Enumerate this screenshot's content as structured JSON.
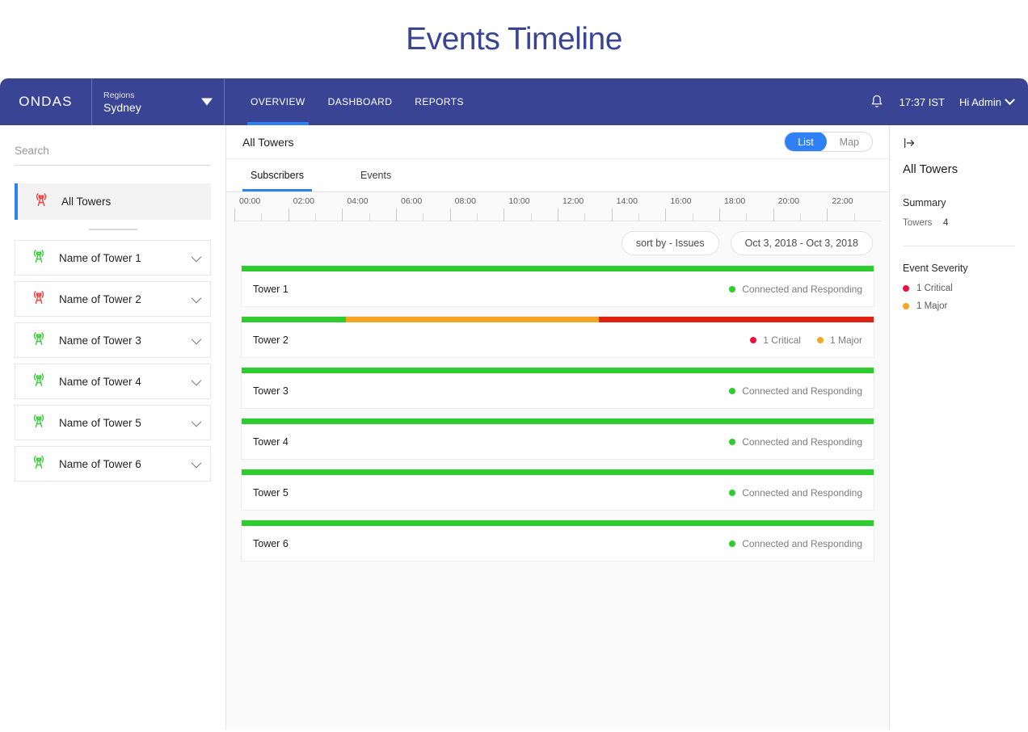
{
  "page": {
    "title": "Events Timeline",
    "title_color": "#3a4494"
  },
  "navbar": {
    "brand": "ONDAS",
    "region_label": "Regions",
    "region_value": "Sydney",
    "caret_icon": "caret-down-icon",
    "tabs": [
      {
        "label": "OVERVIEW",
        "active": true
      },
      {
        "label": "DASHBOARD",
        "active": false
      },
      {
        "label": "REPORTS",
        "active": false
      }
    ],
    "bell_icon": "bell-icon",
    "time": "17:37 IST",
    "user": "Hi Admin",
    "user_caret_icon": "chevron-down-icon",
    "bg_color": "#3a4494",
    "accent_color": "#2f80f5"
  },
  "sidebar": {
    "search_placeholder": "Search",
    "search_value": "",
    "all_towers": {
      "label": "All Towers",
      "icon": "tower-icon",
      "icon_color": "#ef3b3b",
      "selected": true
    },
    "towers": [
      {
        "label": "Name of Tower 1",
        "icon": "tower-icon",
        "icon_color": "#33cc33"
      },
      {
        "label": "Name of Tower 2",
        "icon": "tower-icon",
        "icon_color": "#ef3b3b"
      },
      {
        "label": "Name of Tower 3",
        "icon": "tower-icon",
        "icon_color": "#33cc33"
      },
      {
        "label": "Name of Tower 4",
        "icon": "tower-icon",
        "icon_color": "#33cc33"
      },
      {
        "label": "Name of Tower 5",
        "icon": "tower-icon",
        "icon_color": "#33cc33"
      },
      {
        "label": "Name of Tower 6",
        "icon": "tower-icon",
        "icon_color": "#33cc33"
      }
    ]
  },
  "main": {
    "header_title": "All Towers",
    "view_toggle": {
      "options": [
        "List",
        "Map"
      ],
      "selected": "List"
    },
    "tabs": [
      {
        "label": "Subscribers",
        "active": true
      },
      {
        "label": "Events",
        "active": false
      }
    ],
    "ruler": {
      "labels": [
        "00:00",
        "02:00",
        "04:00",
        "06:00",
        "08:00",
        "10:00",
        "12:00",
        "14:00",
        "16:00",
        "18:00",
        "20:00",
        "22:00"
      ]
    },
    "filters": {
      "sort_by": "sort by - Issues",
      "date_range": "Oct 3, 2018 - Oct 3, 2018"
    },
    "status_ok_text": "Connected and Responding",
    "rows": [
      {
        "name": "Tower 1",
        "segments": [
          {
            "color": "#2ecc2e",
            "pct": 100
          }
        ],
        "badges": [
          {
            "text": "Connected and Responding",
            "dot_color": "#2ecc2e"
          }
        ]
      },
      {
        "name": "Tower 2",
        "segments": [
          {
            "color": "#2ecc2e",
            "pct": 16.5
          },
          {
            "color": "#f5a623",
            "pct": 40.0
          },
          {
            "color": "#e02010",
            "pct": 43.5
          }
        ],
        "badges": [
          {
            "text": "1 Critical",
            "dot_color": "#f01040"
          },
          {
            "text": "1 Major",
            "dot_color": "#f5a623"
          }
        ]
      },
      {
        "name": "Tower 3",
        "segments": [
          {
            "color": "#2ecc2e",
            "pct": 100
          }
        ],
        "badges": [
          {
            "text": "Connected and Responding",
            "dot_color": "#2ecc2e"
          }
        ]
      },
      {
        "name": "Tower 4",
        "segments": [
          {
            "color": "#2ecc2e",
            "pct": 100
          }
        ],
        "badges": [
          {
            "text": "Connected and Responding",
            "dot_color": "#2ecc2e"
          }
        ]
      },
      {
        "name": "Tower 5",
        "segments": [
          {
            "color": "#2ecc2e",
            "pct": 100
          }
        ],
        "badges": [
          {
            "text": "Connected and Responding",
            "dot_color": "#2ecc2e"
          }
        ]
      },
      {
        "name": "Tower 6",
        "segments": [
          {
            "color": "#2ecc2e",
            "pct": 100
          }
        ],
        "badges": [
          {
            "text": "Connected and Responding",
            "dot_color": "#2ecc2e"
          }
        ]
      }
    ]
  },
  "right_panel": {
    "collapse_icon": "panel-collapse-icon",
    "title": "All Towers",
    "summary_heading": "Summary",
    "summary_rows": [
      {
        "key": "Towers",
        "value": "4"
      }
    ],
    "severity_heading": "Event Severity",
    "severity_items": [
      {
        "text": "1 Critical",
        "color": "#f01040"
      },
      {
        "text": "1 Major",
        "color": "#f5a623"
      }
    ]
  }
}
